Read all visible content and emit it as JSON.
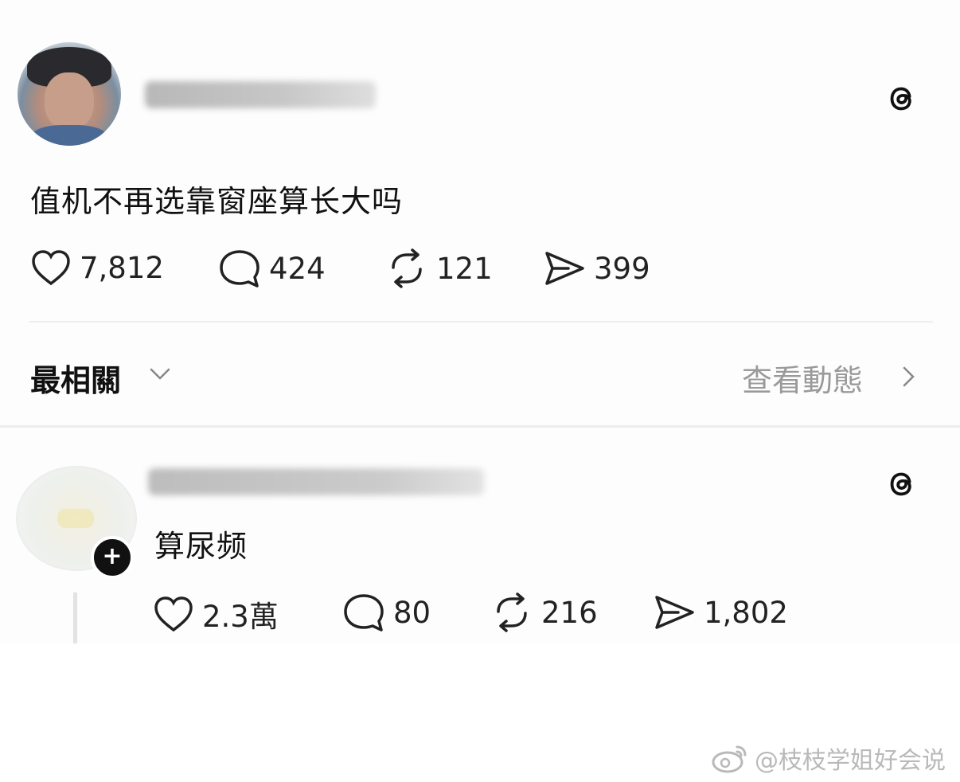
{
  "post": {
    "text": "值机不再选靠窗座算长大吗",
    "stats": {
      "likes": "7,812",
      "comments": "424",
      "reposts": "121",
      "shares": "399"
    }
  },
  "replies_header": {
    "sort_label": "最相關",
    "activity_link": "查看動態"
  },
  "reply": {
    "text": "算尿频",
    "stats": {
      "likes": "2.3萬",
      "comments": "80",
      "reposts": "216",
      "shares": "1,802"
    }
  },
  "watermark": "@枝枝学姐好会说",
  "icons": {
    "like": "heart-icon",
    "comment": "comment-bubble-icon",
    "repost": "repost-icon",
    "share": "send-icon",
    "app": "threads-logo-icon",
    "follow": "plus-icon",
    "watermark": "weibo-icon"
  }
}
